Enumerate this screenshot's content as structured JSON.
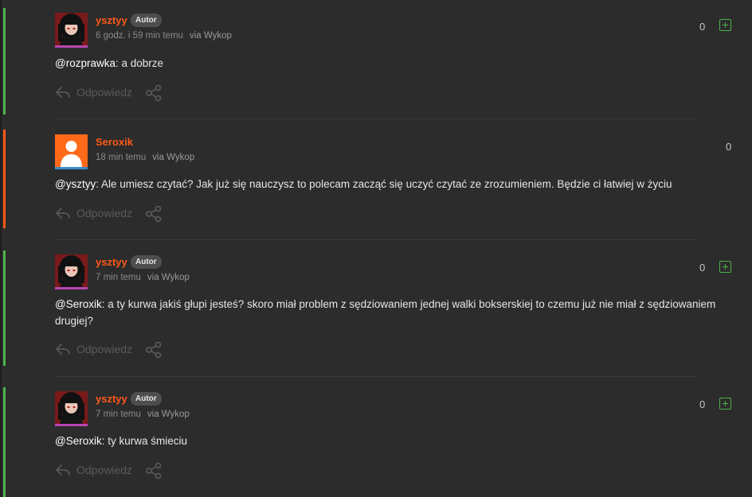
{
  "colors": {
    "background": "#2c2c2c",
    "username": "#ff5917",
    "author_bar": "#4cb34b",
    "other_bar": "#ff5917",
    "plus_icon": "#4cb34b",
    "avatar_underline_author": "#b846b0",
    "avatar_underline_other": "#3a8cc7"
  },
  "comments": [
    {
      "username": "ysztyy",
      "badge": "Autor",
      "time": "6 godz. i 59 min temu",
      "via": "via Wykop",
      "score": "0",
      "mention": "@rozprawka",
      "text": ": a dobrze",
      "reply_label": "Odpowiedz",
      "avatar": "anime-avatar"
    },
    {
      "username": "Seroxik",
      "badge": "",
      "time": "18 min temu",
      "via": "via Wykop",
      "score": "0",
      "mention": "@ysztyy",
      "text": ": Ale umiesz czytać? Jak już się nauczysz to polecam zacząć się uczyć czytać ze zrozumieniem. Będzie ci łatwiej w życiu",
      "reply_label": "Odpowiedz",
      "avatar": "default-user-avatar"
    },
    {
      "username": "ysztyy",
      "badge": "Autor",
      "time": "7 min temu",
      "via": "via Wykop",
      "score": "0",
      "mention": "@Seroxik",
      "text": ": a ty kurwa jakiś głupi jesteś? skoro miał problem z sędziowaniem jednej walki bokserskiej to czemu już nie miał z sędziowaniem drugiej?",
      "reply_label": "Odpowiedz",
      "avatar": "anime-avatar"
    },
    {
      "username": "ysztyy",
      "badge": "Autor",
      "time": "7 min temu",
      "via": "via Wykop",
      "score": "0",
      "mention": "@Seroxik",
      "text": ": ty kurwa śmieciu",
      "reply_label": "Odpowiedz",
      "avatar": "anime-avatar"
    }
  ]
}
